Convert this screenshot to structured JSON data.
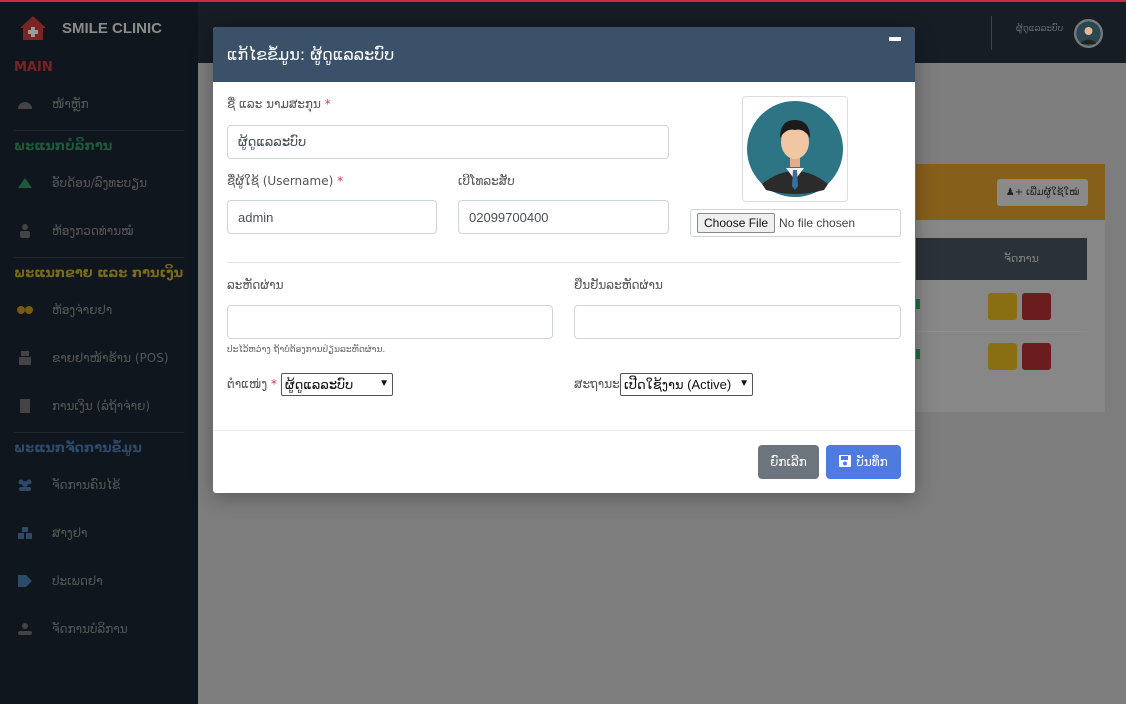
{
  "brand": {
    "name": "SMILE CLINIC"
  },
  "sidebar": {
    "sections": [
      {
        "title": "MAIN",
        "items": [
          {
            "label": "ໜ້າຫຼັກ",
            "icon": "dashboard-icon"
          }
        ]
      },
      {
        "title": "ພະແນກບໍລິການ",
        "items": [
          {
            "label": "ອັບດ້ອນ/ລົງທະບຽນ",
            "icon": "triangle-icon"
          },
          {
            "label": "ຫ້ອງກວດທ່ານໝໍ",
            "icon": "doctor-icon"
          }
        ]
      },
      {
        "title": "ພະແນກຂາຍ ແລະ ການເງິນ",
        "items": [
          {
            "label": "ຫ້ອງຈ່າຍຢາ",
            "icon": "pills-icon"
          },
          {
            "label": "ຂາຍຢາໜ້າຮ້ານ (POS)",
            "icon": "cash-register-icon"
          },
          {
            "label": "ການເງິນ (ລໍຖ້າຈ່າຍ)",
            "icon": "invoice-icon"
          }
        ]
      },
      {
        "title": "ພະແນກຈັດການຂໍ້ມູນ",
        "items": [
          {
            "label": "ຈັດການຄົນໄຂ້",
            "icon": "users-icon"
          },
          {
            "label": "ສາງຢາ",
            "icon": "warehouse-icon"
          },
          {
            "label": "ປະເພດຢາ",
            "icon": "tag-icon"
          },
          {
            "label": "ຈັດການບໍລິການ",
            "icon": "service-icon"
          }
        ]
      }
    ]
  },
  "topbar": {
    "username": "ຜູ້ດູແລລະບົບ"
  },
  "background": {
    "add_user_label": "ເພີ່ມຜູ້ໃຊ້ໃໝ່",
    "manage_header": "ຈັດການ"
  },
  "modal": {
    "title": "ແກ້ໄຂຂໍ້ມູນ: ຜູ້ດູແລລະບົບ",
    "fullname_label": "ຊື່ ແລະ ນາມສະກຸນ",
    "fullname_value": "ຜູ້ດູແລລະບົບ",
    "username_label": "ຊື່ຜູ້ໃຊ້ (Username)",
    "username_value": "admin",
    "phone_label": "ເບີໂທລະສັບ",
    "phone_value": "02099700400",
    "file_button": "Choose File",
    "file_status": "No file chosen",
    "password_label": "ລະຫັດຜ່ານ",
    "password_value": "",
    "confirm_label": "ຢືນຢັນລະຫັດຜ່ານ",
    "confirm_value": "",
    "password_help": "ປະໄວ້ຫວ່າງ ຖ້າບໍ່ຕ້ອງການປ່ຽນລະຫັດຜ່ານ.",
    "role_label": "ຕຳແໜ່ງ",
    "role_value": "ຜູ້ດູແລລະບົບ",
    "status_label": "ສະຖານະ",
    "status_value": "ເປີດໃຊ້ງານ (Active)",
    "required_mark": "*",
    "cancel_label": "ຍົກເລີກ",
    "save_label": "ບັນທຶກ"
  },
  "colors": {
    "modal_header": "#3b5169",
    "save_button": "#4f7be0",
    "cancel_button": "#6c757d",
    "required": "#dc3545"
  }
}
